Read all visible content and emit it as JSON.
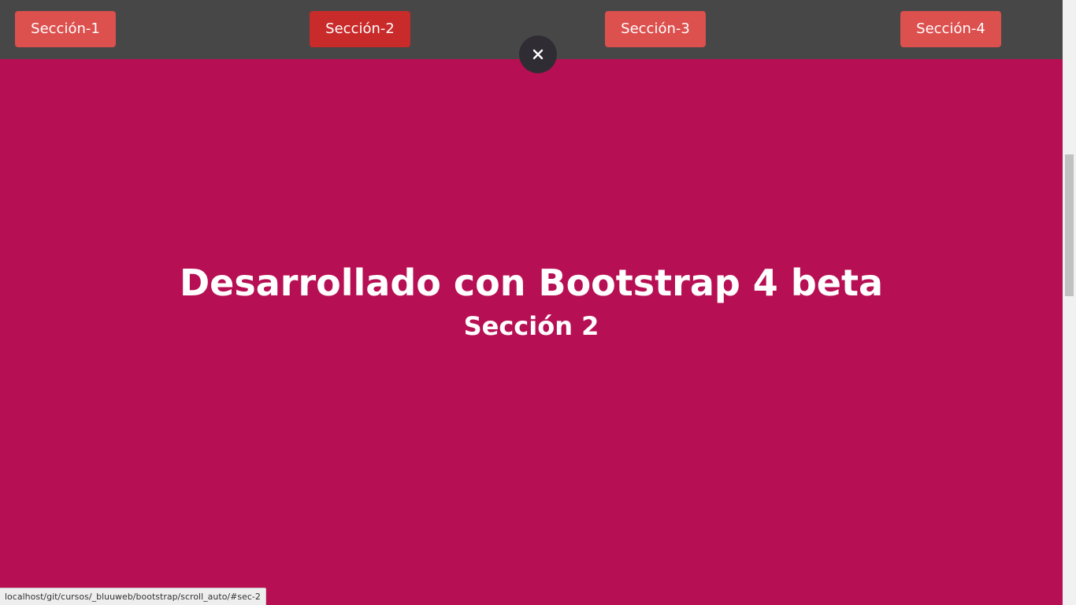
{
  "navbar": {
    "buttons": [
      {
        "label": "Sección-1",
        "active": false
      },
      {
        "label": "Sección-2",
        "active": true
      },
      {
        "label": "Sección-3",
        "active": false
      },
      {
        "label": "Sección-4",
        "active": false
      }
    ],
    "close_icon": "close-icon"
  },
  "hero": {
    "title": "Desarrollado con Bootstrap 4 beta",
    "subtitle": "Sección 2"
  },
  "status_bar": {
    "url": "localhost/git/cursos/_bluuweb/bootstrap/scroll_auto/#sec-2"
  },
  "colors": {
    "navbar_bg": "#474747",
    "button_bg": "#dc504e",
    "button_active_bg": "#c92a2a",
    "section_bg": "#b70f54",
    "close_bg": "#2f2d33"
  }
}
